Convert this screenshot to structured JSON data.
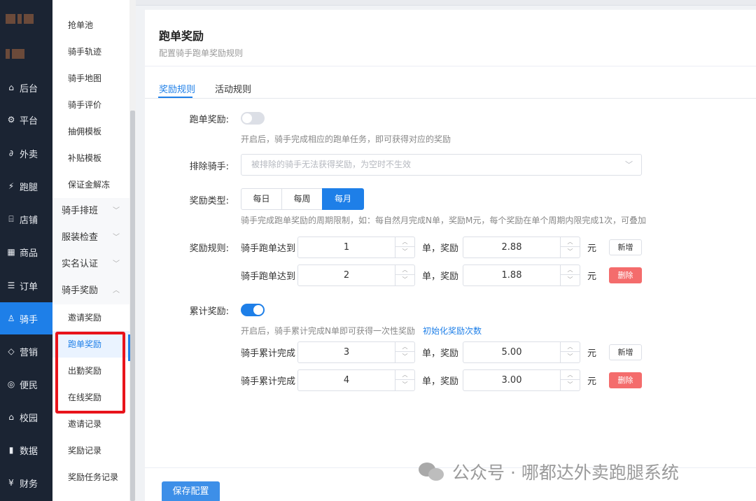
{
  "rail": {
    "items": [
      {
        "icon": "home-icon",
        "glyph": "⌂",
        "label": "后台"
      },
      {
        "icon": "gear-icon",
        "glyph": "⚙",
        "label": "平台"
      },
      {
        "icon": "takeout-icon",
        "glyph": "∂",
        "label": "外卖"
      },
      {
        "icon": "runner-icon",
        "glyph": "⚡",
        "label": "跑腿"
      },
      {
        "icon": "store-icon",
        "glyph": "⌸",
        "label": "店铺"
      },
      {
        "icon": "grid-icon",
        "glyph": "▦",
        "label": "商品"
      },
      {
        "icon": "order-icon",
        "glyph": "☰",
        "label": "订单"
      },
      {
        "icon": "rider-icon",
        "glyph": "♙",
        "label": "骑手"
      },
      {
        "icon": "diamond-icon",
        "glyph": "◇",
        "label": "营销"
      },
      {
        "icon": "service-icon",
        "glyph": "◎",
        "label": "便民"
      },
      {
        "icon": "campus-icon",
        "glyph": "⌂",
        "label": "校园"
      },
      {
        "icon": "chart-icon",
        "glyph": "▮",
        "label": "数据"
      },
      {
        "icon": "yen-icon",
        "glyph": "¥",
        "label": "财务"
      }
    ]
  },
  "submenu": {
    "items": [
      {
        "label": "抢单池",
        "type": "item"
      },
      {
        "label": "骑手轨迹",
        "type": "item"
      },
      {
        "label": "骑手地图",
        "type": "item"
      },
      {
        "label": "骑手评价",
        "type": "item"
      },
      {
        "label": "抽佣模板",
        "type": "item"
      },
      {
        "label": "补贴模板",
        "type": "item"
      },
      {
        "label": "保证金解冻",
        "type": "item"
      },
      {
        "label": "骑手排班",
        "type": "group",
        "chev": "﹀"
      },
      {
        "label": "服装检查",
        "type": "group",
        "chev": "﹀"
      },
      {
        "label": "实名认证",
        "type": "group",
        "chev": "﹀"
      },
      {
        "label": "骑手奖励",
        "type": "group",
        "chev": "︿"
      },
      {
        "label": "邀请奖励",
        "type": "item"
      },
      {
        "label": "跑单奖励",
        "type": "item"
      },
      {
        "label": "出勤奖励",
        "type": "item"
      },
      {
        "label": "在线奖励",
        "type": "item"
      },
      {
        "label": "邀请记录",
        "type": "item"
      },
      {
        "label": "奖励记录",
        "type": "item"
      },
      {
        "label": "奖励任务记录",
        "type": "item"
      }
    ]
  },
  "page": {
    "title": "跑单奖励",
    "subtitle": "配置骑手跑单奖励规则",
    "tabs": [
      "奖励规则",
      "活动规则"
    ]
  },
  "form": {
    "run_reward_label": "跑单奖励:",
    "run_reward_on": false,
    "run_reward_hint": "开启后，骑手完成相应的跑单任务，即可获得对应的奖励",
    "exclude_label": "排除骑手:",
    "exclude_placeholder": "被排除的骑手无法获得奖励，为空时不生效",
    "reward_type_label": "奖励类型:",
    "reward_type_options": [
      "每日",
      "每周",
      "每月"
    ],
    "reward_type_selected": "每月",
    "reward_type_hint": "骑手完成跑单奖励的周期限制，如：每自然月完成N单，奖励M元，每个奖励在单个周期内限完成1次，可叠加",
    "rules_label": "奖励规则:",
    "rules": [
      {
        "prefix": "骑手跑单达到",
        "count": "1",
        "mid": "单，奖励",
        "amount": "2.88",
        "unit": "元",
        "action": "新增"
      },
      {
        "prefix": "骑手跑单达到",
        "count": "2",
        "mid": "单，奖励",
        "amount": "1.88",
        "unit": "元",
        "action": "删除"
      }
    ],
    "cumulative_label": "累计奖励:",
    "cumulative_on": true,
    "cumulative_hint": "开启后，骑手累计完成N单即可获得一次性奖励",
    "cumulative_link": "初始化奖励次数",
    "cumulative_rules": [
      {
        "prefix": "骑手累计完成",
        "count": "3",
        "mid": "单，奖励",
        "amount": "5.00",
        "unit": "元",
        "action": "新增"
      },
      {
        "prefix": "骑手累计完成",
        "count": "4",
        "mid": "单，奖励",
        "amount": "3.00",
        "unit": "元",
        "action": "删除"
      }
    ],
    "save_label": "保存配置"
  },
  "watermark": {
    "text": "公众号 · 哪都达外卖跑腿系统"
  },
  "colors": {
    "primary": "#1e7fe8",
    "danger": "#f46c6c",
    "rail_bg": "#1b2433",
    "highlight_box": "#e8141b"
  }
}
